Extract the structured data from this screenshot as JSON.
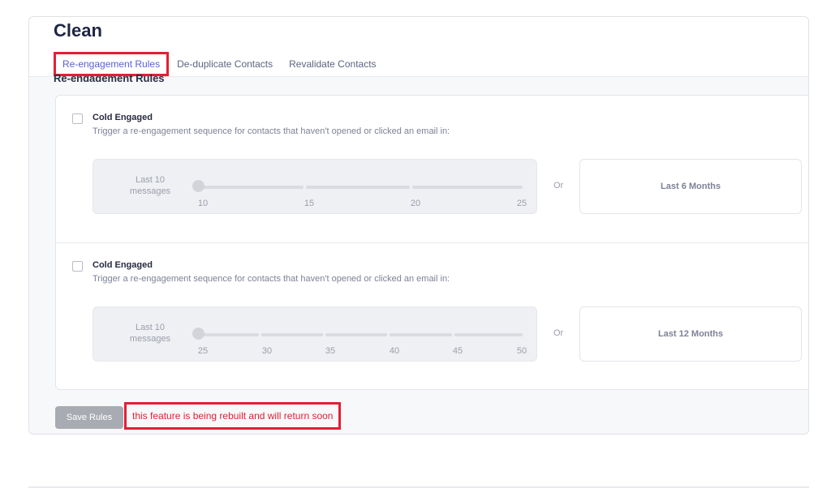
{
  "page": {
    "title": "Clean"
  },
  "tabs": [
    {
      "label": "Re-engagement Rules",
      "active": true
    },
    {
      "label": "De-duplicate Contacts",
      "active": false
    },
    {
      "label": "Revalidate Contacts",
      "active": false
    }
  ],
  "section_heading": "Re-engagement Rules",
  "rules": [
    {
      "title": "Cold Engaged",
      "description": "Trigger a re-engagement sequence for contacts that haven't opened or clicked an email in:",
      "checked": false,
      "slider_label": "Last 10 messages",
      "slider_ticks": [
        "10",
        "15",
        "20",
        "25"
      ],
      "slider_value": 10,
      "or_label": "Or",
      "period_label": "Last 6 Months"
    },
    {
      "title": "Cold Engaged",
      "description": "Trigger a re-engagement sequence for contacts that haven't opened or clicked an email in:",
      "checked": false,
      "slider_label": "Last 10 messages",
      "slider_ticks": [
        "25",
        "30",
        "35",
        "40",
        "45",
        "50"
      ],
      "slider_value": 25,
      "or_label": "Or",
      "period_label": "Last 12 Months"
    }
  ],
  "footer": {
    "save_label": "Save Rules",
    "notice": "this feature is being rebuilt and will return soon"
  },
  "colors": {
    "accent": "#5b5fd6",
    "alert": "#e21f36",
    "disabled": "#a9abb2"
  }
}
